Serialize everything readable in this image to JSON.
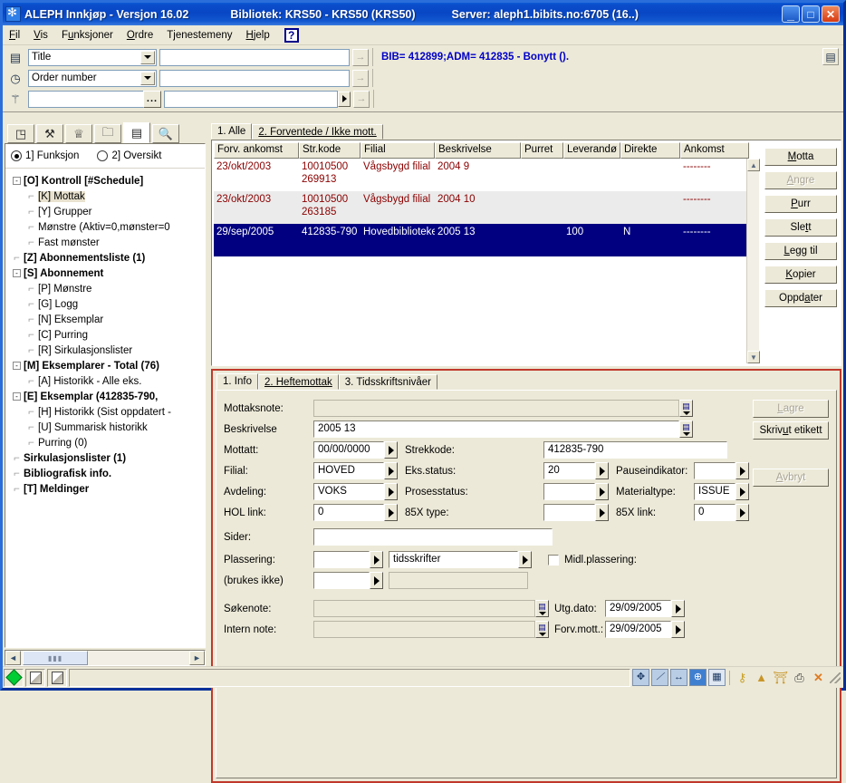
{
  "window": {
    "app_title": "ALEPH Innkjøp - Versjon 16.02",
    "library": "Bibliotek:  KRS50 - KRS50 (KRS50)",
    "server": "Server:  aleph1.bibits.no:6705 (16..)",
    "minimize": "_",
    "maximize": "□",
    "close": "✕",
    "icon": "aleph-app-icon"
  },
  "menubar": {
    "items": [
      "Fil",
      "Vis",
      "Funksjoner",
      "Ordre",
      "Tjenestemeny",
      "Hjelp"
    ],
    "help_glyph": "?"
  },
  "search": {
    "row1": {
      "icon": "list-icon",
      "select_value": "Title",
      "input_value": "",
      "go": "→"
    },
    "row2": {
      "icon": "clock-icon",
      "select_value": "Order number",
      "input_value": "",
      "go": "→"
    },
    "row3": {
      "icon": "barcode-scan-icon",
      "input_value": "",
      "browse": "...",
      "input2_value": "",
      "go": "→"
    },
    "bib_line": "BIB= 412899;ADM= 412835 - Bonytt ().",
    "right_icon": "record-list-icon"
  },
  "left_panel": {
    "tabs": [
      {
        "name": "tab-orders",
        "glyph": "◳"
      },
      {
        "name": "tab-serials",
        "glyph": "⚒"
      },
      {
        "name": "tab-vendors",
        "glyph": "♕"
      },
      {
        "name": "tab-folder",
        "glyph": "🗀"
      },
      {
        "name": "tab-records",
        "glyph": "▤",
        "active": true
      },
      {
        "name": "tab-search",
        "glyph": "🔍"
      }
    ],
    "radios": [
      {
        "label": "1] Funksjon",
        "selected": true
      },
      {
        "label": "2] Oversikt",
        "selected": false
      }
    ],
    "tree": [
      {
        "label": "[O] Kontroll [#Schedule]",
        "level": 0,
        "bold": true,
        "toggle": "-"
      },
      {
        "label": "[K] Mottak",
        "level": 1,
        "bold": false,
        "selected": true
      },
      {
        "label": "[Y] Grupper",
        "level": 1,
        "bold": false
      },
      {
        "label": "Mønstre (Aktiv=0,mønster=0",
        "level": 1,
        "bold": false
      },
      {
        "label": "Fast mønster",
        "level": 1,
        "bold": false
      },
      {
        "label": "[Z] Abonnementsliste (1)",
        "level": 0,
        "bold": true,
        "toggle": ""
      },
      {
        "label": "[S] Abonnement",
        "level": 0,
        "bold": true,
        "toggle": "-"
      },
      {
        "label": "[P] Mønstre",
        "level": 1,
        "bold": false
      },
      {
        "label": "[G] Logg",
        "level": 1,
        "bold": false
      },
      {
        "label": "[N] Eksemplar",
        "level": 1,
        "bold": false
      },
      {
        "label": "[C] Purring",
        "level": 1,
        "bold": false
      },
      {
        "label": "[R] Sirkulasjonslister",
        "level": 1,
        "bold": false
      },
      {
        "label": "[M] Eksemplarer - Total (76)",
        "level": 0,
        "bold": true,
        "toggle": "-"
      },
      {
        "label": "[A] Historikk - Alle eks.",
        "level": 1,
        "bold": false
      },
      {
        "label": "[E] Eksemplar (412835-790,",
        "level": 0,
        "bold": true,
        "toggle": "-"
      },
      {
        "label": "[H] Historikk (Sist oppdatert -",
        "level": 1,
        "bold": false
      },
      {
        "label": "[U] Summarisk historikk",
        "level": 1,
        "bold": false
      },
      {
        "label": "Purring (0)",
        "level": 1,
        "bold": false
      },
      {
        "label": "Sirkulasjonslister (1)",
        "level": 0,
        "bold": true,
        "toggle": ""
      },
      {
        "label": "Bibliografisk info.",
        "level": 0,
        "bold": true,
        "toggle": ""
      },
      {
        "label": "[T] Meldinger",
        "level": 0,
        "bold": true,
        "toggle": ""
      }
    ],
    "hscroll": {
      "left": "◄",
      "right": "►",
      "thumb": "▮▮▮"
    }
  },
  "top_panel": {
    "tabs": [
      {
        "label": "1. Alle",
        "active": true
      },
      {
        "label": "2. Forventede / Ikke mott.",
        "active": false
      }
    ],
    "grid": {
      "columns": [
        "Forv. ankomst",
        "Str.kode",
        "Filial",
        "Beskrivelse",
        "Purret",
        "Leverandø",
        "Direkte",
        "Ankomst"
      ],
      "rows": [
        {
          "selected": false,
          "cells": [
            "23/okt/2003",
            "10010500 269913",
            "Vågsbygd filial",
            "2004 9",
            "",
            "",
            "",
            "--------"
          ]
        },
        {
          "selected": false,
          "cells": [
            "23/okt/2003",
            "10010500 263185",
            "Vågsbygd filial",
            "2004 10",
            "",
            "",
            "",
            "--------"
          ]
        },
        {
          "selected": true,
          "cells": [
            "29/sep/2005",
            "412835-790",
            "Hovedbiblioteket",
            "2005 13",
            "",
            "100",
            "N",
            "--------"
          ]
        }
      ]
    },
    "buttons": [
      {
        "label": "Motta",
        "disabled": false
      },
      {
        "label": "Angre",
        "disabled": true
      },
      {
        "label": "Purr",
        "disabled": false
      },
      {
        "label": "Slett",
        "disabled": false
      },
      {
        "label": "Legg til",
        "disabled": false
      },
      {
        "label": "Kopier",
        "disabled": false
      },
      {
        "label": "Oppdater",
        "disabled": false
      }
    ]
  },
  "form_panel": {
    "tabs": [
      {
        "label": "1. Info",
        "active": true
      },
      {
        "label": "2. Heftemottak",
        "active": false
      },
      {
        "label": "3. Tidsskriftsnivåer",
        "active": false
      }
    ],
    "fields": {
      "mottaksnote_label": "Mottaksnote:",
      "mottaksnote_value": "",
      "beskrivelse_label": "Beskrivelse",
      "beskrivelse_value": "2005   13",
      "mottatt_label": "Mottatt:",
      "mottatt_value": "00/00/0000",
      "strekkode_label": "Strekkode:",
      "strekkode_value": "412835-790",
      "filial_label": "Filial:",
      "filial_value": "HOVED",
      "eks_status_label": "Eks.status:",
      "eks_status_value": "20",
      "pauseindikator_label": "Pauseindikator:",
      "pauseindikator_value": "",
      "avdeling_label": "Avdeling:",
      "avdeling_value": "VOKS",
      "prosesstatus_label": "Prosesstatus:",
      "prosesstatus_value": "",
      "materialtype_label": "Materialtype:",
      "materialtype_value": "ISSUE",
      "hol_link_label": "HOL link:",
      "hol_link_value": "0",
      "x85_type_label": "85X type:",
      "x85_type_value": "",
      "x85_link_label": "85X link:",
      "x85_link_value": "0",
      "sider_label": "Sider:",
      "sider_value": "",
      "plassering_label": "Plassering:",
      "plassering_value": "",
      "plassering_value2": "tidsskrifter",
      "midl_plassering_label": "Midl.plassering:",
      "midl_plassering_checked": false,
      "brukes_ikke_label": "(brukes ikke)",
      "brukes_ikke_value": "",
      "brukes_ikke_value2": "",
      "sokenote_label": "Søkenote:",
      "sokenote_value": "",
      "utg_dato_label": "Utg.dato:",
      "utg_dato_value": "29/09/2005",
      "intern_note_label": "Intern note:",
      "intern_note_value": "",
      "forv_mott_label": "Forv.mott.:",
      "forv_mott_value": "29/09/2005"
    },
    "buttons": [
      {
        "label": "Lagre",
        "disabled": true
      },
      {
        "label": "Skriv ut etikett",
        "disabled": false
      },
      {
        "label": "Avbryt",
        "disabled": true
      }
    ]
  },
  "statusbar": {
    "left_icons": [
      "green-diamond-icon",
      "cube-icon",
      "cube-icon"
    ],
    "message": "",
    "right_icons": [
      {
        "name": "navigate-icon",
        "glyph": "✥"
      },
      {
        "name": "marc-icon",
        "glyph": "⟋"
      },
      {
        "name": "link-icon",
        "glyph": "↔"
      },
      {
        "name": "globe-icon",
        "glyph": "🌐"
      },
      {
        "name": "table-icon",
        "glyph": "▦"
      },
      {
        "name": "key-icon",
        "glyph": "⚿"
      },
      {
        "name": "tower-icon",
        "glyph": "▲"
      },
      {
        "name": "library-icon",
        "glyph": "🏛"
      },
      {
        "name": "printer-icon",
        "glyph": "🖶"
      },
      {
        "name": "close-x-icon",
        "glyph": "✕"
      }
    ]
  },
  "colors": {
    "title_blue": "#0845c4",
    "panel_bg": "#ece9d8",
    "row_text": "#8b0000",
    "selection": "#000080",
    "form_border": "#c0392b",
    "bib_text": "#0000c8"
  }
}
